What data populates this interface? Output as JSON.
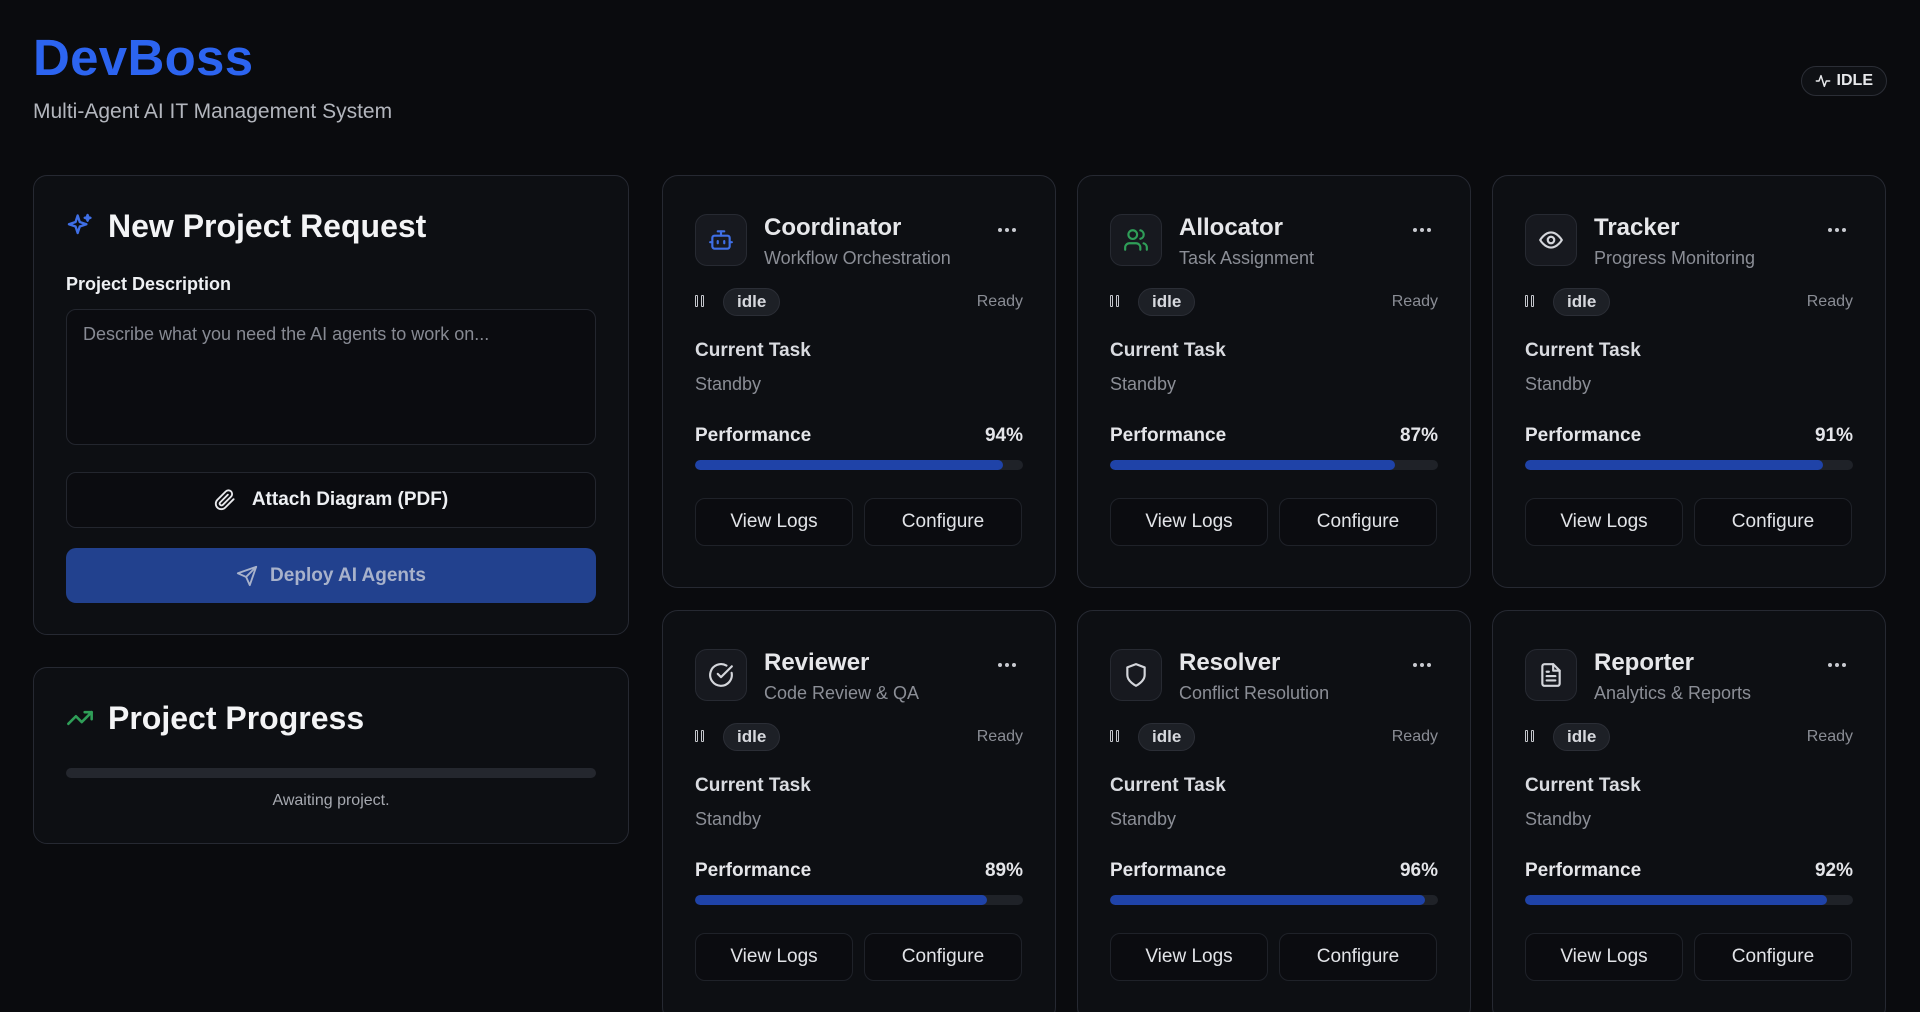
{
  "app": {
    "title": "DevBoss",
    "subtitle": "Multi-Agent AI IT Management System",
    "status": "IDLE",
    "accent_color": "#2c64f0"
  },
  "request": {
    "heading": "New Project Request",
    "heading_icon": "sparkles-icon",
    "description_label": "Project Description",
    "description_placeholder": "Describe what you need the AI agents to work on...",
    "description_value": "",
    "attach_label": "Attach Diagram (PDF)",
    "attach_icon": "paperclip-icon",
    "deploy_label": "Deploy AI Agents",
    "deploy_icon": "send-icon"
  },
  "progress": {
    "heading": "Project Progress",
    "heading_icon": "trending-up-icon",
    "value": 0,
    "caption": "Awaiting project."
  },
  "agent_common": {
    "current_task_label": "Current Task",
    "performance_label": "Performance",
    "view_logs_label": "View Logs",
    "configure_label": "Configure",
    "more_label": "···"
  },
  "agents": [
    {
      "name": "Coordinator",
      "role": "Workflow Orchestration",
      "icon": "bot-icon",
      "icon_color": "#3f6fe6",
      "status": "idle",
      "state": "Ready",
      "task": "Standby",
      "performance": 94,
      "performance_label": "94%"
    },
    {
      "name": "Allocator",
      "role": "Task Assignment",
      "icon": "users-icon",
      "icon_color": "#2f9e58",
      "status": "idle",
      "state": "Ready",
      "task": "Standby",
      "performance": 87,
      "performance_label": "87%"
    },
    {
      "name": "Tracker",
      "role": "Progress Monitoring",
      "icon": "eye-icon",
      "icon_color": "#d4d6db",
      "status": "idle",
      "state": "Ready",
      "task": "Standby",
      "performance": 91,
      "performance_label": "91%"
    },
    {
      "name": "Reviewer",
      "role": "Code Review & QA",
      "icon": "check-circle-icon",
      "icon_color": "#d4d6db",
      "status": "idle",
      "state": "Ready",
      "task": "Standby",
      "performance": 89,
      "performance_label": "89%"
    },
    {
      "name": "Resolver",
      "role": "Conflict Resolution",
      "icon": "shield-icon",
      "icon_color": "#d4d6db",
      "status": "idle",
      "state": "Ready",
      "task": "Standby",
      "performance": 96,
      "performance_label": "96%"
    },
    {
      "name": "Reporter",
      "role": "Analytics & Reports",
      "icon": "file-text-icon",
      "icon_color": "#d4d6db",
      "status": "idle",
      "state": "Ready",
      "task": "Standby",
      "performance": 92,
      "performance_label": "92%"
    }
  ]
}
